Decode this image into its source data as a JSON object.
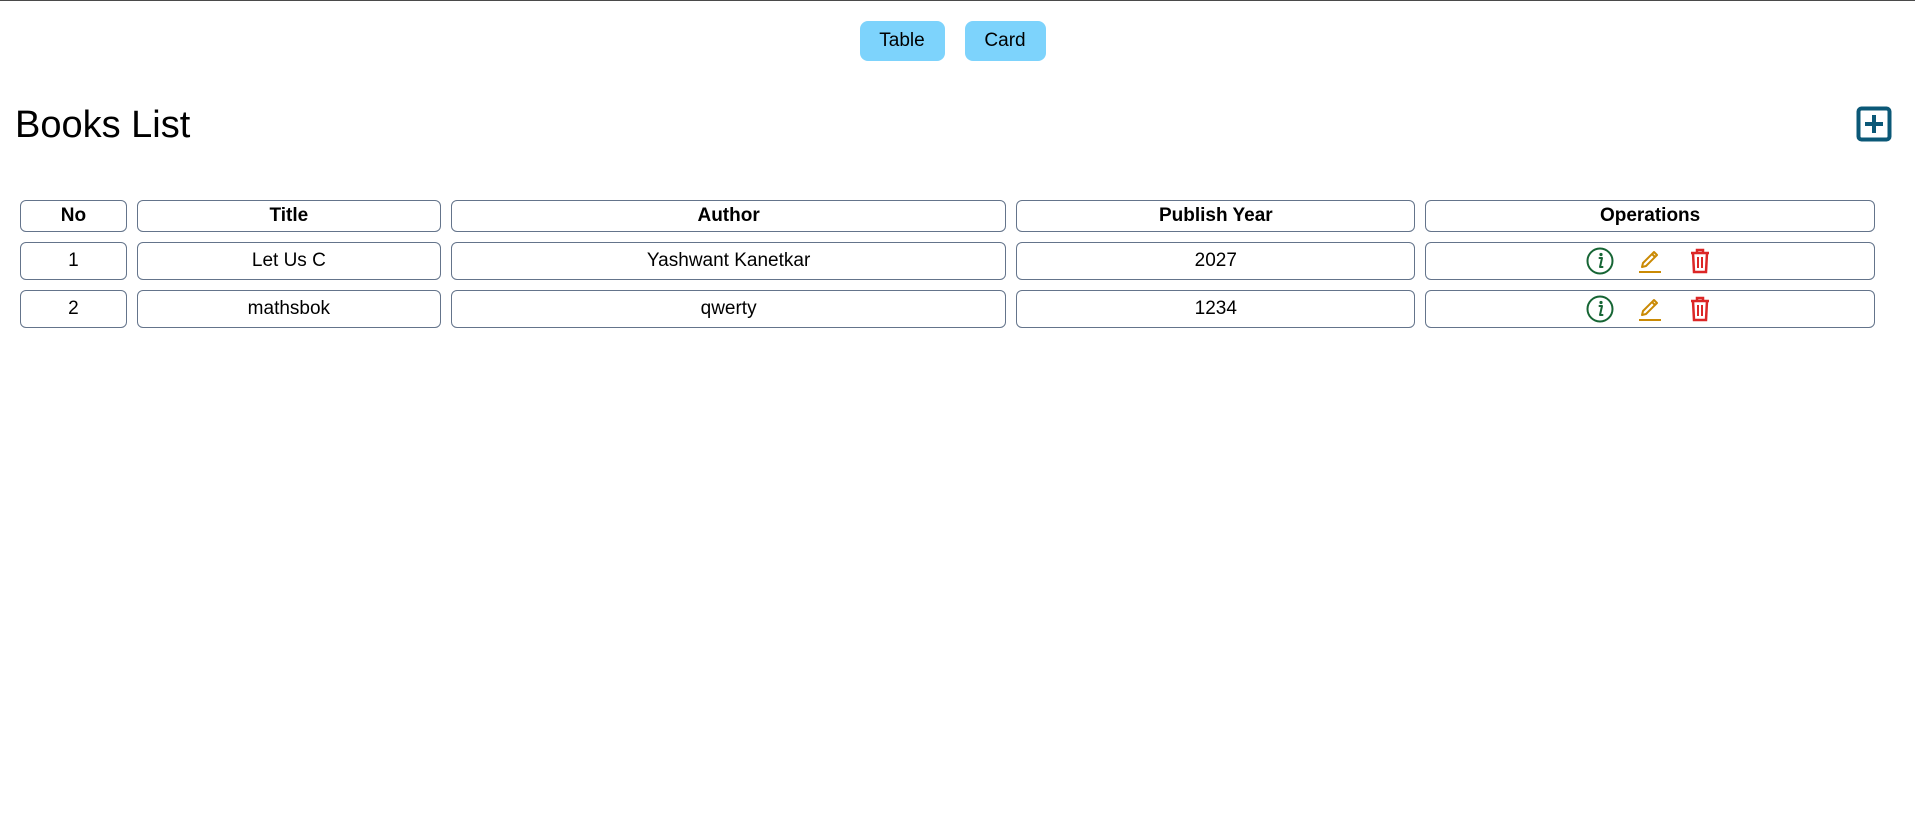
{
  "view_toggle": {
    "table_label": "Table",
    "card_label": "Card"
  },
  "page": {
    "title": "Books List"
  },
  "icons": {
    "add": "plus-square-icon",
    "info": "info-circle-icon",
    "edit": "pencil-icon",
    "delete": "trash-icon"
  },
  "colors": {
    "toggle_bg": "#7dd3fc",
    "add_icon": "#0b5877",
    "info_icon": "#166534",
    "edit_icon": "#ca8a04",
    "delete_icon": "#dc2626",
    "border": "#64748b"
  },
  "table": {
    "headers": {
      "no": "No",
      "title": "Title",
      "author": "Author",
      "year": "Publish Year",
      "ops": "Operations"
    },
    "rows": [
      {
        "no": "1",
        "title": "Let Us C",
        "author": "Yashwant Kanetkar",
        "year": "2027"
      },
      {
        "no": "2",
        "title": "mathsbok",
        "author": "qwerty",
        "year": "1234"
      }
    ]
  }
}
